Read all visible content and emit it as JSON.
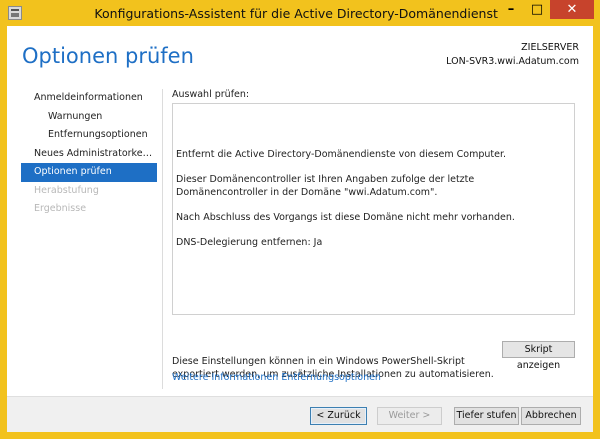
{
  "window": {
    "title": "Konfigurations-Assistent für die Active Directory-Domänendienste",
    "minimize": "–",
    "maximize": "□",
    "close": "✕"
  },
  "header": {
    "page_title": "Optionen prüfen",
    "server_caption": "ZIELSERVER",
    "server_name": "LON-SVR3.wwi.Adatum.com"
  },
  "nav": {
    "items": [
      {
        "label": "Anmeldeinformationen"
      },
      {
        "label": "Warnungen"
      },
      {
        "label": "Entfernungsoptionen"
      },
      {
        "label": "Neues Administratorkenn..."
      },
      {
        "label": "Optionen prüfen"
      },
      {
        "label": "Herabstufung"
      },
      {
        "label": "Ergebnisse"
      }
    ]
  },
  "main": {
    "section_label": "Auswahl prüfen:",
    "review_lines": [
      "Entfernt die Active Directory-Domänendienste von diesem Computer.",
      "Dieser Domänencontroller ist Ihren Angaben zufolge der letzte Domänencontroller in der Domäne \"wwi.Adatum.com\".",
      "Nach Abschluss des Vorgangs ist diese Domäne nicht mehr vorhanden.",
      "DNS-Delegierung entfernen: Ja"
    ],
    "export_text": "Diese Einstellungen können in ein Windows PowerShell-Skript exportiert werden, um zusätzliche Installationen zu automatisieren.",
    "show_script_label": "Skript anzeigen",
    "more_info_link": "Weitere Informationen Entfernungsoptionen"
  },
  "footer": {
    "back_label": "< Zurück",
    "next_label": "Weiter >",
    "demote_label": "Tiefer stufen",
    "cancel_label": "Abbrechen"
  },
  "colors": {
    "window_frame": "#f2c21d",
    "accent": "#1e6fc5",
    "close_button": "#c7432c"
  }
}
